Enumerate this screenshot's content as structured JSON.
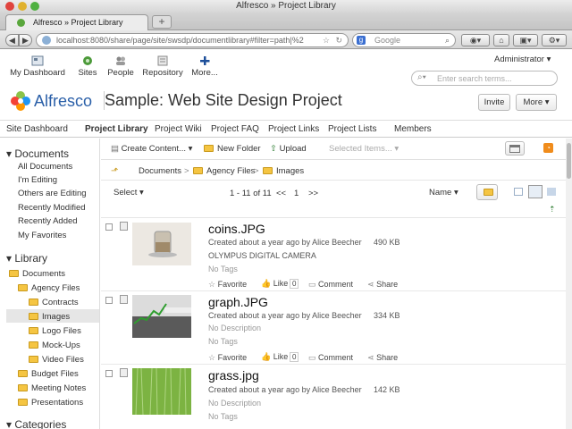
{
  "window": {
    "title": "Alfresco » Project Library",
    "tab_title": "Alfresco » Project Library",
    "new_tab": "+"
  },
  "browser": {
    "url": "localhost:8080/share/page/site/swsdp/documentlibrary#filter=path|%2",
    "search_placeholder": "Google"
  },
  "app": {
    "nav": [
      "My Dashboard",
      "Sites",
      "People",
      "Repository",
      "More..."
    ],
    "user": "Administrator",
    "search_placeholder": "Enter search terms...",
    "logo": "Alfresco",
    "site_title": "Sample: Web Site Design Project",
    "invite_label": "Invite",
    "more_label": "More"
  },
  "site_nav": [
    "Site Dashboard",
    "Project Library",
    "Project Wiki",
    "Project FAQ",
    "Project Links",
    "Project Lists",
    "Members"
  ],
  "left": {
    "documents_header": "Documents",
    "filters": [
      "All Documents",
      "I'm Editing",
      "Others are Editing",
      "Recently Modified",
      "Recently Added",
      "My Favorites"
    ],
    "library_header": "Library",
    "tree": [
      "Documents",
      "Agency Files",
      "Contracts",
      "Images",
      "Logo Files",
      "Mock-Ups",
      "Video Files",
      "Budget Files",
      "Meeting Notes",
      "Presentations"
    ],
    "categories_header": "Categories"
  },
  "toolbar": {
    "create": "Create Content...",
    "new_folder": "New Folder",
    "upload": "Upload",
    "selected": "Selected Items..."
  },
  "breadcrumb": [
    "Documents",
    "Agency Files",
    "Images"
  ],
  "list": {
    "select": "Select",
    "paging": "1 - 11 of 11",
    "prev": "<<",
    "page": "1",
    "next": ">>",
    "sort": "Name"
  },
  "files": [
    {
      "name": "coins.JPG",
      "meta": "Created about a year ago by Alice Beecher",
      "size": "490 KB",
      "desc": "OLYMPUS DIGITAL CAMERA",
      "tags": "No Tags",
      "likes": "0"
    },
    {
      "name": "graph.JPG",
      "meta": "Created about a year ago by Alice Beecher",
      "size": "334 KB",
      "desc": "No Description",
      "tags": "No Tags",
      "likes": "0"
    },
    {
      "name": "grass.jpg",
      "meta": "Created about a year ago by Alice Beecher",
      "size": "142 KB",
      "desc": "No Description",
      "tags": "No Tags",
      "likes": "0"
    }
  ],
  "actions": {
    "favorite": "Favorite",
    "like": "Like",
    "comment": "Comment",
    "share": "Share"
  }
}
